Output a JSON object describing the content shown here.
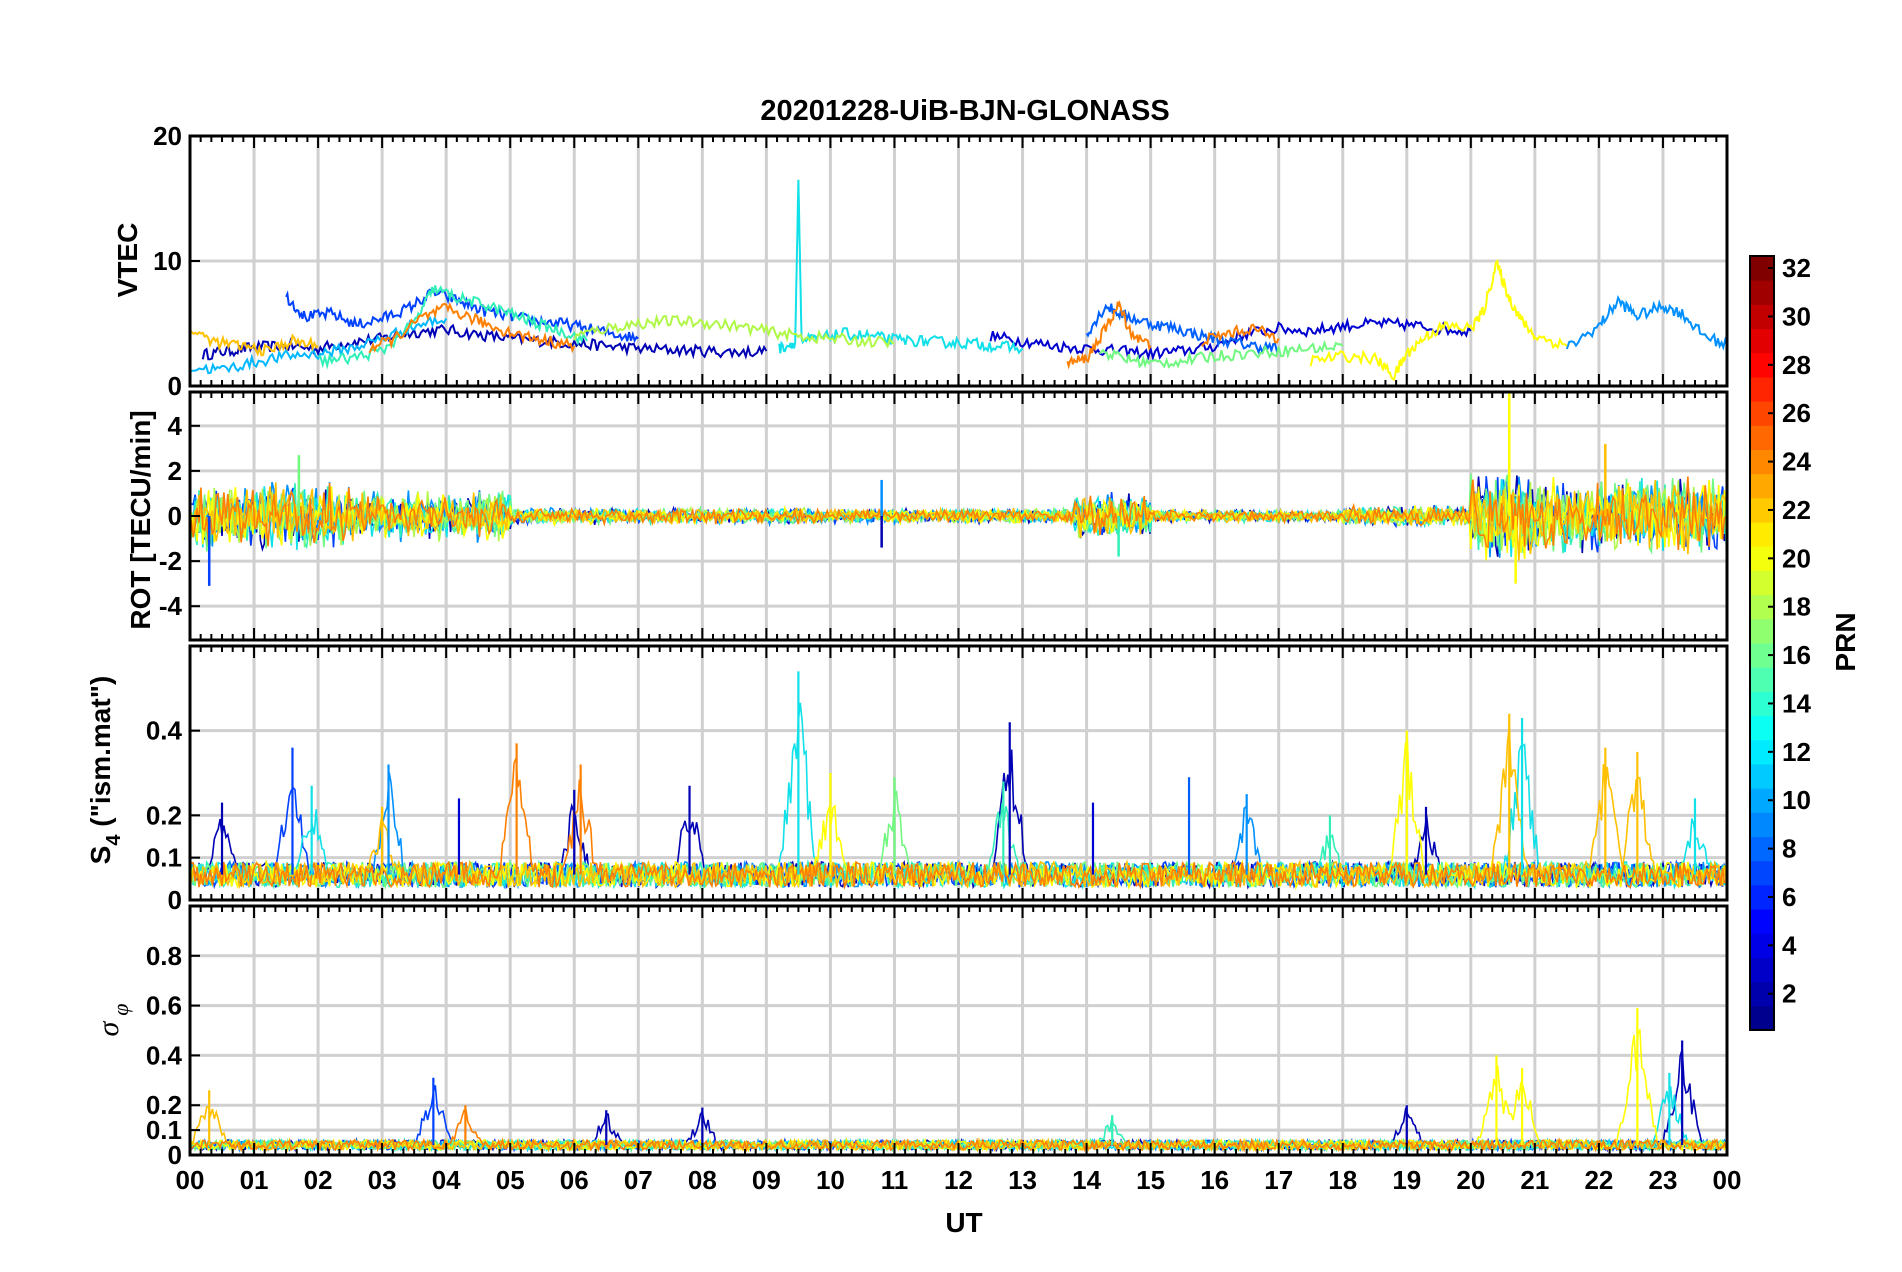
{
  "chart_data": [
    {
      "type": "line",
      "panel": "vtec",
      "title": "20201228-UiB-BJN-GLONASS",
      "ylabel": "VTEC",
      "ylim": [
        0,
        20
      ],
      "yticks": [
        0,
        10,
        20
      ],
      "xlim": [
        0,
        24
      ],
      "xticks": [
        "00",
        "01",
        "02",
        "03",
        "04",
        "05",
        "06",
        "07",
        "08",
        "09",
        "10",
        "11",
        "12",
        "13",
        "14",
        "15",
        "16",
        "17",
        "18",
        "19",
        "20",
        "21",
        "22",
        "23",
        "00"
      ],
      "grid": true,
      "series": [
        {
          "prn": 2,
          "color": "#0000b4",
          "x": [
            0.2,
            0.6,
            1.0,
            1.5,
            2.0,
            2.5,
            3.0,
            3.5,
            4.0,
            4.5,
            5.0,
            5.5,
            6.0,
            6.5,
            7.0,
            7.5,
            8.0,
            8.5,
            9.0
          ],
          "y": [
            2.5,
            2.8,
            3.1,
            3.2,
            3.0,
            3.5,
            3.8,
            4.3,
            4.5,
            4.1,
            3.8,
            3.6,
            3.4,
            3.2,
            3.0,
            2.9,
            2.8,
            2.7,
            2.8
          ]
        },
        {
          "prn": 3,
          "color": "#0000d0",
          "x": [
            12.5,
            13.0,
            13.5,
            14.0,
            14.5,
            15.0,
            15.5,
            16.0,
            16.5,
            17.0,
            17.5,
            18.0,
            18.5,
            19.0,
            19.5,
            20.0
          ],
          "y": [
            4.0,
            3.6,
            3.2,
            3.0,
            2.8,
            2.6,
            2.8,
            3.2,
            4.2,
            4.6,
            4.4,
            4.8,
            5.0,
            4.9,
            4.6,
            4.4
          ]
        },
        {
          "prn": 5,
          "color": "#0040ff",
          "x": [
            1.5,
            1.8,
            2.2,
            2.6,
            3.0,
            3.4,
            3.8,
            4.2,
            4.6,
            5.0,
            5.4,
            5.8,
            6.2,
            6.6,
            7.0
          ],
          "y": [
            7.2,
            5.5,
            5.8,
            4.9,
            5.4,
            6.2,
            7.5,
            6.8,
            6.0,
            5.6,
            5.2,
            5.0,
            4.6,
            4.2,
            3.8
          ]
        },
        {
          "prn": 6,
          "color": "#0060ff",
          "x": [
            14.0,
            14.3,
            14.6,
            15.0,
            15.4,
            15.8,
            16.2,
            16.6,
            17.0
          ],
          "y": [
            4.2,
            6.4,
            5.6,
            5.0,
            4.6,
            4.0,
            3.6,
            3.2,
            3.0
          ]
        },
        {
          "prn": 8,
          "color": "#0090ff",
          "x": [
            21.5,
            22.0,
            22.3,
            22.6,
            23.0,
            23.3,
            23.6,
            24.0
          ],
          "y": [
            3.0,
            4.8,
            6.8,
            5.6,
            6.4,
            5.8,
            4.2,
            3.2
          ]
        },
        {
          "prn": 10,
          "color": "#00b8ff",
          "x": [
            0.0,
            0.5,
            1.0,
            1.5,
            2.0,
            2.5,
            3.0,
            3.5,
            4.0
          ],
          "y": [
            1.5,
            1.3,
            1.9,
            2.4,
            2.6,
            3.0,
            3.8,
            4.8,
            5.4
          ]
        },
        {
          "prn": 12,
          "color": "#10e0e8",
          "x": [
            9.2,
            9.45,
            9.5,
            9.55,
            9.8,
            10.2,
            10.6,
            11.0,
            11.4,
            11.8,
            12.2,
            12.6,
            13.0
          ],
          "y": [
            3.0,
            3.5,
            16.5,
            3.6,
            3.8,
            4.2,
            4.0,
            3.7,
            3.6,
            3.5,
            3.4,
            3.2,
            3.0
          ]
        },
        {
          "prn": 14,
          "color": "#30f0b8",
          "x": [
            2.0,
            2.5,
            3.0,
            3.5,
            3.8,
            4.2,
            4.6,
            5.0,
            5.4,
            5.8,
            6.2
          ],
          "y": [
            2.0,
            2.2,
            2.8,
            5.0,
            7.8,
            7.0,
            6.5,
            5.8,
            5.0,
            4.4,
            3.6
          ]
        },
        {
          "prn": 16,
          "color": "#70f880",
          "x": [
            14.2,
            14.6,
            15.0,
            15.5,
            16.0,
            16.5,
            17.0,
            17.5,
            18.0
          ],
          "y": [
            2.8,
            2.2,
            1.8,
            2.0,
            2.4,
            2.6,
            2.8,
            3.0,
            3.2
          ]
        },
        {
          "prn": 18,
          "color": "#b0f848",
          "x": [
            6.0,
            6.5,
            7.0,
            7.5,
            8.0,
            8.5,
            9.0,
            9.5,
            10.0,
            10.5,
            11.0
          ],
          "y": [
            4.0,
            4.6,
            5.0,
            5.2,
            5.1,
            4.8,
            4.4,
            4.0,
            3.8,
            3.6,
            3.4
          ]
        },
        {
          "prn": 20,
          "color": "#ffff00",
          "x": [
            17.5,
            18.0,
            18.5,
            18.8,
            19.0,
            19.3,
            19.6,
            20.0,
            20.2,
            20.4,
            20.6,
            20.8,
            21.0,
            21.5
          ],
          "y": [
            2.0,
            2.4,
            2.2,
            0.8,
            2.6,
            4.0,
            4.8,
            4.6,
            6.0,
            9.8,
            7.0,
            5.2,
            4.0,
            3.2
          ]
        },
        {
          "prn": 22,
          "color": "#ffc000",
          "x": [
            0.0,
            0.4,
            0.8,
            1.2,
            1.6,
            2.0
          ],
          "y": [
            4.5,
            3.5,
            3.2,
            2.8,
            3.6,
            3.2
          ]
        },
        {
          "prn": 24,
          "color": "#ff8000",
          "x": [
            2.8,
            3.2,
            3.6,
            4.0,
            4.4,
            4.8,
            5.2,
            5.6,
            6.0
          ],
          "y": [
            3.0,
            3.8,
            5.4,
            6.2,
            5.4,
            4.6,
            4.0,
            3.6,
            3.2
          ]
        },
        {
          "prn": 24,
          "color": "#ff8000",
          "x": [
            13.7,
            14.0,
            14.3,
            14.5,
            14.7,
            15.0
          ],
          "y": [
            1.8,
            2.2,
            4.6,
            6.5,
            4.2,
            3.2
          ]
        },
        {
          "prn": 24,
          "color": "#ff8000",
          "x": [
            15.8,
            16.2,
            16.6,
            17.0
          ],
          "y": [
            3.6,
            4.2,
            4.6,
            3.8
          ]
        }
      ]
    },
    {
      "type": "line",
      "panel": "rot",
      "ylabel": "ROT [TECU/min]",
      "ylim": [
        -5.5,
        5.5
      ],
      "yticks": [
        -4,
        -2,
        0,
        2,
        4
      ],
      "xlim": [
        0,
        24
      ],
      "grid": true,
      "activity": [
        {
          "x": [
            0,
            2.5
          ],
          "amplitude": 1.6
        },
        {
          "x": [
            2.5,
            5.0
          ],
          "amplitude": 1.2
        },
        {
          "x": [
            5.0,
            10.0
          ],
          "amplitude": 0.4
        },
        {
          "x": [
            10.0,
            13.8
          ],
          "amplitude": 0.35
        },
        {
          "x": [
            13.8,
            15.0
          ],
          "amplitude": 1.1
        },
        {
          "x": [
            15.0,
            18.0
          ],
          "amplitude": 0.3
        },
        {
          "x": [
            18.0,
            20.0
          ],
          "amplitude": 0.5
        },
        {
          "x": [
            20.0,
            21.0
          ],
          "amplitude": 2.2
        },
        {
          "x": [
            21.0,
            24.0
          ],
          "amplitude": 1.8
        }
      ],
      "spikes": [
        {
          "x": 20.6,
          "y": 5.5,
          "color": "#ffff00"
        },
        {
          "x": 20.7,
          "y": -3.0,
          "color": "#ffff00"
        },
        {
          "x": 22.1,
          "y": 3.2,
          "color": "#ffc000"
        },
        {
          "x": 0.3,
          "y": -3.1,
          "color": "#0040ff"
        },
        {
          "x": 1.7,
          "y": 2.7,
          "color": "#70f880"
        },
        {
          "x": 14.5,
          "y": -1.8,
          "color": "#30f0b8"
        },
        {
          "x": 10.8,
          "y": 1.6,
          "color": "#0090ff"
        },
        {
          "x": 10.8,
          "y": -1.4,
          "color": "#0000b4"
        }
      ],
      "colors": [
        "#0000b4",
        "#0040ff",
        "#0090ff",
        "#10e0e8",
        "#30f0b8",
        "#70f880",
        "#b0f848",
        "#ffff00",
        "#ffc000",
        "#ff8000"
      ]
    },
    {
      "type": "line",
      "panel": "s4",
      "ylabel": "S",
      "ylabel_sub": "4",
      "ylabel_rest": " (\"ism.mat\")",
      "ylim": [
        0,
        0.6
      ],
      "yticks": [
        0,
        0.1,
        0.2,
        0.4
      ],
      "ytick_labels": [
        "0",
        "0.1",
        "0.2",
        "0.4"
      ],
      "xlim": [
        0,
        24
      ],
      "grid": true,
      "baseline": 0.06,
      "peaks": [
        {
          "x": 0.5,
          "y": 0.23,
          "color": "#0000b4"
        },
        {
          "x": 1.6,
          "y": 0.36,
          "color": "#0040ff"
        },
        {
          "x": 1.9,
          "y": 0.27,
          "color": "#10e0e8"
        },
        {
          "x": 3.0,
          "y": 0.22,
          "color": "#ffc000"
        },
        {
          "x": 3.1,
          "y": 0.32,
          "color": "#0090ff"
        },
        {
          "x": 4.2,
          "y": 0.24,
          "color": "#0000d0"
        },
        {
          "x": 5.1,
          "y": 0.37,
          "color": "#ff8000"
        },
        {
          "x": 6.0,
          "y": 0.26,
          "color": "#0000b4"
        },
        {
          "x": 6.1,
          "y": 0.32,
          "color": "#ff8000"
        },
        {
          "x": 7.8,
          "y": 0.27,
          "color": "#0000b4"
        },
        {
          "x": 9.5,
          "y": 0.54,
          "color": "#10e0e8"
        },
        {
          "x": 10.0,
          "y": 0.3,
          "color": "#ffff00"
        },
        {
          "x": 11.0,
          "y": 0.29,
          "color": "#70f880"
        },
        {
          "x": 12.8,
          "y": 0.42,
          "color": "#0000b4"
        },
        {
          "x": 12.7,
          "y": 0.28,
          "color": "#30f0b8"
        },
        {
          "x": 14.1,
          "y": 0.23,
          "color": "#0000d0"
        },
        {
          "x": 15.6,
          "y": 0.29,
          "color": "#0060ff"
        },
        {
          "x": 16.5,
          "y": 0.25,
          "color": "#0090ff"
        },
        {
          "x": 17.8,
          "y": 0.2,
          "color": "#30f0b8"
        },
        {
          "x": 19.0,
          "y": 0.4,
          "color": "#ffff00"
        },
        {
          "x": 19.3,
          "y": 0.22,
          "color": "#0000b4"
        },
        {
          "x": 20.6,
          "y": 0.44,
          "color": "#ffc000"
        },
        {
          "x": 20.8,
          "y": 0.43,
          "color": "#10e0e8"
        },
        {
          "x": 22.1,
          "y": 0.36,
          "color": "#ffc000"
        },
        {
          "x": 22.6,
          "y": 0.35,
          "color": "#ffc000"
        },
        {
          "x": 23.5,
          "y": 0.24,
          "color": "#10e0e8"
        }
      ]
    },
    {
      "type": "line",
      "panel": "sigma_phi",
      "ylabel": "σ",
      "ylabel_sub": "φ",
      "ylim": [
        0,
        1
      ],
      "yticks": [
        0,
        0.1,
        0.2,
        0.4,
        0.6,
        0.8
      ],
      "ytick_labels": [
        "0",
        "0.1",
        "0.2",
        "0.4",
        "0.6",
        "0.8"
      ],
      "xlim": [
        0,
        24
      ],
      "xlabel": "UT",
      "grid": true,
      "baseline": 0.04,
      "peaks": [
        {
          "x": 0.3,
          "y": 0.26,
          "color": "#ffc000"
        },
        {
          "x": 3.8,
          "y": 0.31,
          "color": "#0040ff"
        },
        {
          "x": 4.3,
          "y": 0.2,
          "color": "#ff8000"
        },
        {
          "x": 6.5,
          "y": 0.18,
          "color": "#0000b4"
        },
        {
          "x": 8.0,
          "y": 0.19,
          "color": "#0000b4"
        },
        {
          "x": 14.4,
          "y": 0.16,
          "color": "#30f0b8"
        },
        {
          "x": 19.0,
          "y": 0.2,
          "color": "#0000b4"
        },
        {
          "x": 20.4,
          "y": 0.4,
          "color": "#ffff00"
        },
        {
          "x": 20.8,
          "y": 0.35,
          "color": "#ffff00"
        },
        {
          "x": 22.6,
          "y": 0.59,
          "color": "#ffff00"
        },
        {
          "x": 23.3,
          "y": 0.46,
          "color": "#0000b4"
        },
        {
          "x": 23.1,
          "y": 0.33,
          "color": "#10e0e8"
        }
      ]
    }
  ],
  "colorbar": {
    "label": "PRN",
    "min": 1,
    "max": 32,
    "ticks": [
      "2",
      "4",
      "6",
      "8",
      "10",
      "12",
      "14",
      "16",
      "18",
      "20",
      "22",
      "24",
      "26",
      "28",
      "30",
      "32"
    ]
  }
}
